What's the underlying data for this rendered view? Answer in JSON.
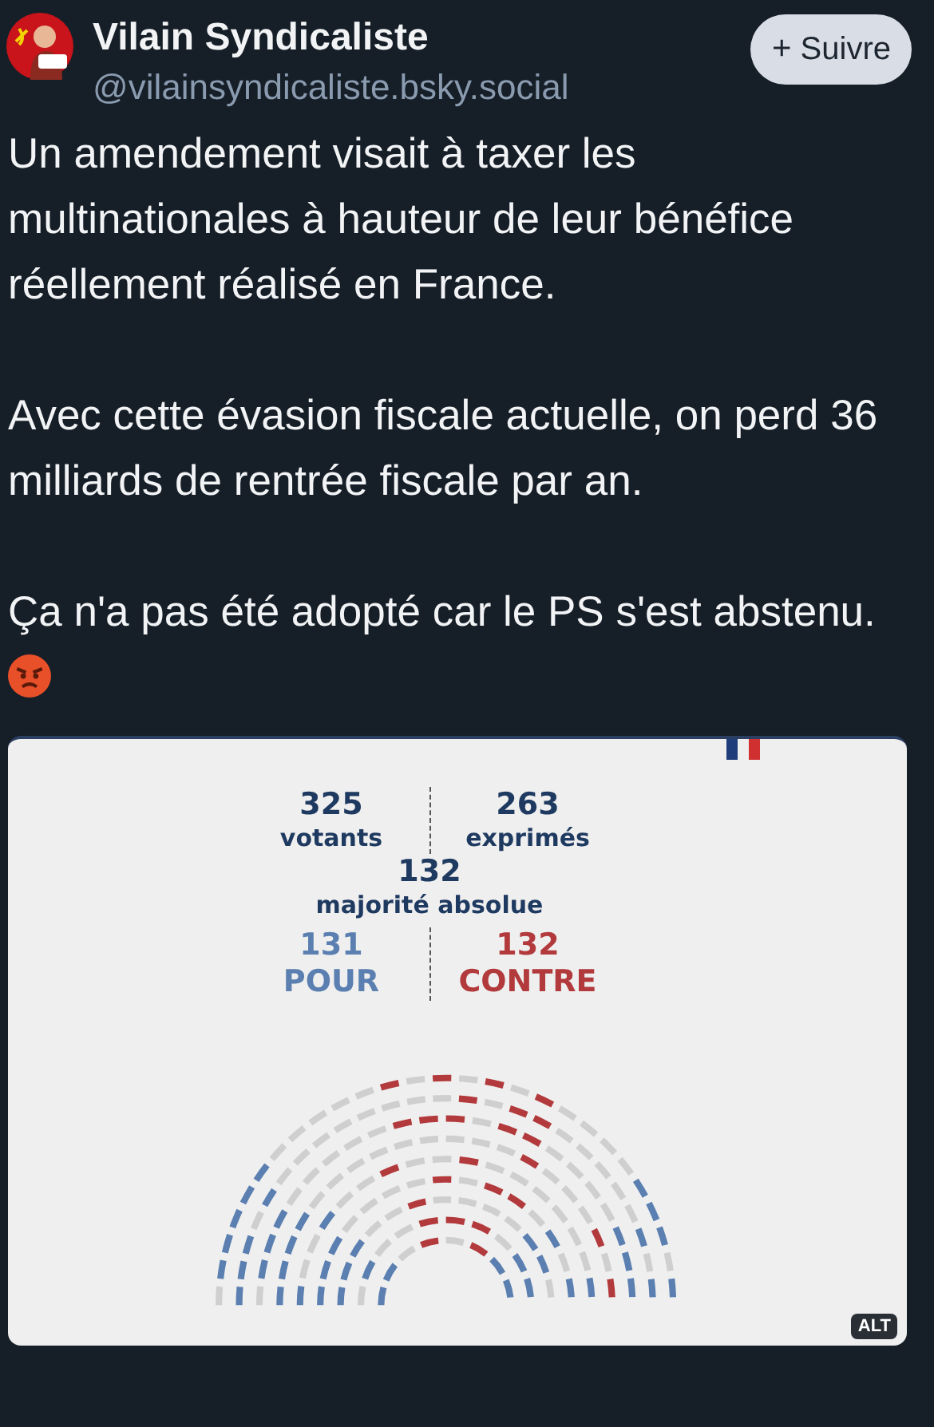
{
  "author": {
    "name": "Vilain Syndicaliste",
    "handle": "@vilainsyndicaliste.bsky.social"
  },
  "follow_button": {
    "icon": "+",
    "label": "Suivre"
  },
  "paragraphs": [
    "Un amendement visait à taxer les multinationales à hauteur de leur bénéfice réellement réalisé en France.",
    "Avec cette évasion fiscale actuelle, on perd 36 milliards de rentrée fiscale par an.",
    "Ça n'a pas été adopté car le PS s'est abstenu."
  ],
  "image": {
    "stats": [
      {
        "value": "325",
        "label": "votants"
      },
      {
        "value": "263",
        "label": "exprimés"
      }
    ],
    "majority": {
      "value": "132",
      "label": "majorité absolue"
    },
    "results": [
      {
        "value": "131",
        "label": "POUR",
        "color": "#5a7fb0"
      },
      {
        "value": "132",
        "label": "CONTRE",
        "color": "#b23a3c"
      }
    ],
    "alt_badge": "ALT"
  }
}
